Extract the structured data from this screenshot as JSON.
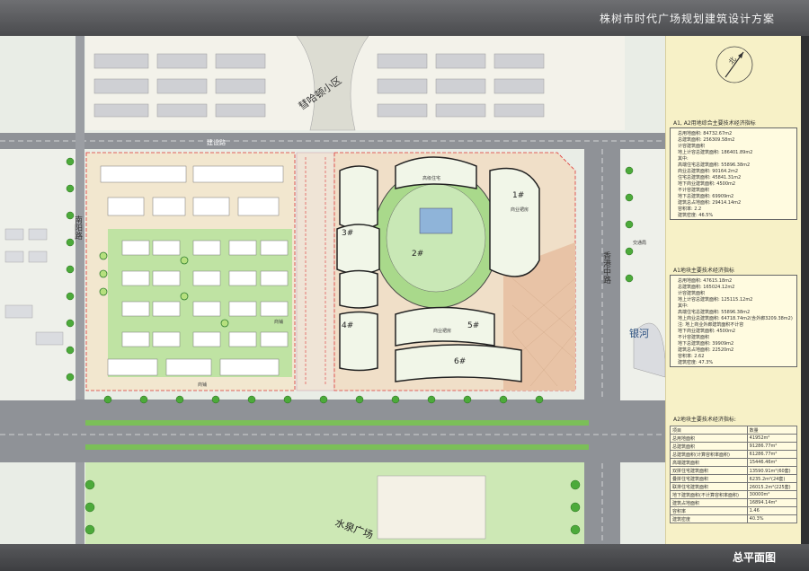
{
  "title": "株树市时代广场规划建筑设计方案",
  "footer_label": "总平面图",
  "compass_label": "北",
  "map_labels": {
    "district": "彗哈顿小区",
    "road_left": "南阳路",
    "road_right": "香港中路",
    "road_top": "建设路",
    "road_bottom": "水泉广场",
    "bank": "银河",
    "traffic": "交通局",
    "b1": "1#",
    "b2": "2#",
    "b3": "3#",
    "b4": "4#",
    "b5": "5#",
    "b6": "6#",
    "t1": "商业裙房",
    "t2": "高级住宅",
    "t3": "商铺",
    "t4": "商业裙房",
    "t5": "商铺"
  },
  "a1": {
    "title": "A1, A2用地综合主要技术经济指标",
    "lines": [
      "总用地面积: 84732.67m2",
      "总建筑面积: 256309.58m2",
      "计容建筑面积",
      "地上计容总建筑面积: 186401.89m2",
      "其中:",
      "高端住宅总建筑面积: 55896.38m2",
      "商业总建筑面积: 90164.2m2",
      "住宅总建筑面积: 45841.31m2",
      "地下商业建筑面积: 4500m2",
      "不计容建筑面积",
      "地下总建筑面积: 69909m2",
      "建筑总占地面积: 29414.14m2",
      "容积率: 2.2",
      "建筑密度: 46.5%"
    ]
  },
  "a1b": {
    "title": "A1地块主要技术经济指标",
    "lines": [
      "总用地面积: 47615.18m2",
      "总建筑面积: 165024.12m2",
      "计容建筑面积",
      "地上计容总建筑面积: 125115.12m2",
      "其中:",
      "高端住宅总建筑面积: 55896.38m2",
      "地上商业总建筑面积: 64718.74m2(含外廊3209.38m2)",
      "注: 地上商业外廊建筑面积不计容",
      "地下商业建筑面积: 4500m2",
      "不计容建筑面积",
      "地下总建筑面积: 39909m2",
      "建筑总占地面积: 22520m2",
      "容积率: 2.62",
      "建筑密度: 47.3%"
    ]
  },
  "a2": {
    "title": "A2地块主要技术经济指标:",
    "header": [
      "项目",
      "数量"
    ],
    "rows": [
      [
        "总用地面积",
        "41952m²"
      ],
      [
        "总建筑面积",
        "91286.77m²"
      ],
      [
        "总建筑面积(计算容积率面积)",
        "61286.77m²"
      ],
      [
        "高端建筑面积",
        "15446.46m²"
      ],
      [
        "双拼住宅建筑面积",
        "13590.91m²(60套)"
      ],
      [
        "叠拼住宅建筑面积",
        "6235.2m²(24套)"
      ],
      [
        "联排住宅建筑面积",
        "26015.2m²(225套)"
      ],
      [
        "地下建筑面积(不计算容积率面积)",
        "30000m²"
      ],
      [
        "建筑占地面积",
        "16894.14m²"
      ],
      [
        "容积率",
        "1.46"
      ],
      [
        "建筑密度",
        "40.3%"
      ]
    ]
  }
}
